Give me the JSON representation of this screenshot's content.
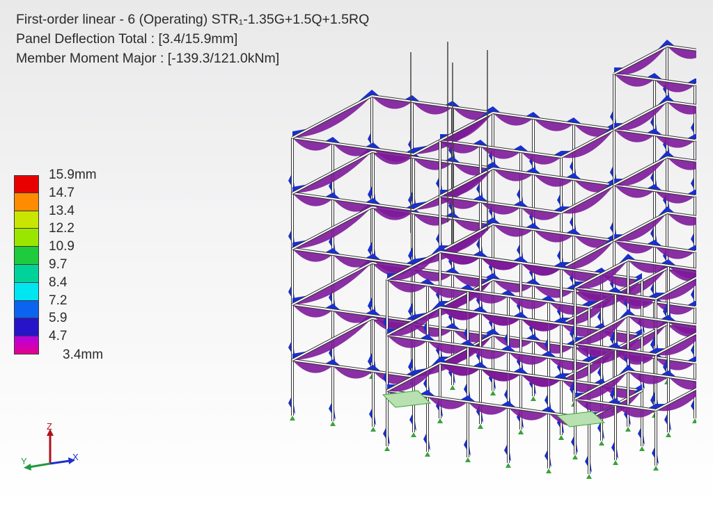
{
  "header": {
    "line1": "First-order linear - 6 (Operating) STR₁-1.35G+1.5Q+1.5RQ",
    "line2": "Panel Deflection Total : [3.4/15.9mm]",
    "line3": "Member Moment Major  : [-139.3/121.0kNm]"
  },
  "legend": {
    "items": [
      {
        "label": "15.9mm",
        "color": "#e60000"
      },
      {
        "label": "14.7",
        "color": "#ff8c00"
      },
      {
        "label": "13.4",
        "color": "#c8e600"
      },
      {
        "label": "12.2",
        "color": "#9be600"
      },
      {
        "label": "10.9",
        "color": "#1ecb3c"
      },
      {
        "label": "9.7",
        "color": "#00d29a"
      },
      {
        "label": "8.4",
        "color": "#00e6f0"
      },
      {
        "label": "7.2",
        "color": "#0a64f0"
      },
      {
        "label": "5.9",
        "color": "#2814c8"
      },
      {
        "label": "4.7",
        "color": "#b400e6"
      }
    ],
    "end_label": "3.4mm",
    "end_color": "#e6008c"
  },
  "axes": {
    "x": "X",
    "y": "Y",
    "z": "Z"
  },
  "colors": {
    "moment_positive": "#7d1a9a",
    "moment_negative": "#1a2fd0",
    "member": "#ffffff",
    "support": "#3aa23a"
  }
}
